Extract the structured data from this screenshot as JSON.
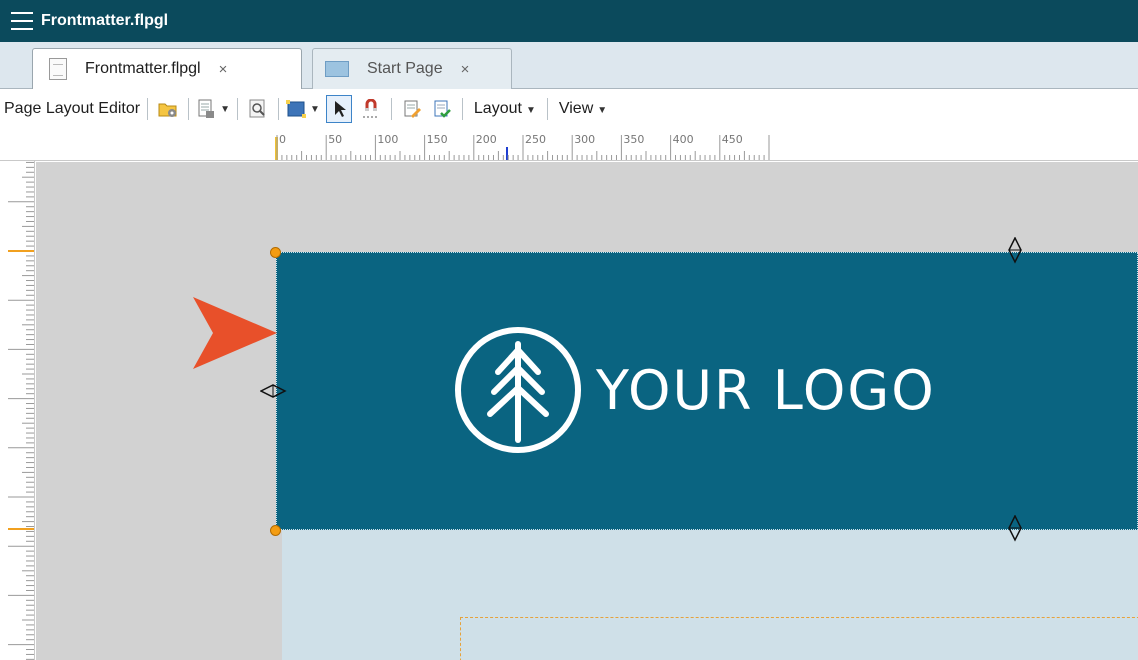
{
  "window": {
    "title": "Frontmatter.flpgl"
  },
  "tabs": [
    {
      "label": "Frontmatter.flpgl",
      "close": "×",
      "active": true
    },
    {
      "label": "Start Page",
      "close": "×",
      "active": false
    }
  ],
  "toolbar": {
    "editor_label": "Page Layout Editor",
    "layout_menu": "Layout",
    "view_menu": "View"
  },
  "ruler": {
    "labels": [
      "0",
      "50",
      "100",
      "150",
      "200",
      "250",
      "300",
      "350",
      "400",
      "450"
    ]
  },
  "canvas": {
    "logo_text": "YOUR LOGO"
  },
  "colors": {
    "title_bar": "#0b4a5c",
    "banner": "#0a6481",
    "page": "#cfe0e8",
    "canvas": "#d2d2d2",
    "callout_arrow": "#e8502a",
    "handle": "#f39c12"
  },
  "icons": [
    "menu-icon",
    "document-icon",
    "start-page-icon",
    "open-folder-icon",
    "page-icon",
    "zoom-icon",
    "frame-icon",
    "pointer-icon",
    "snap-icon",
    "edit-properties-icon",
    "apply-icon"
  ]
}
